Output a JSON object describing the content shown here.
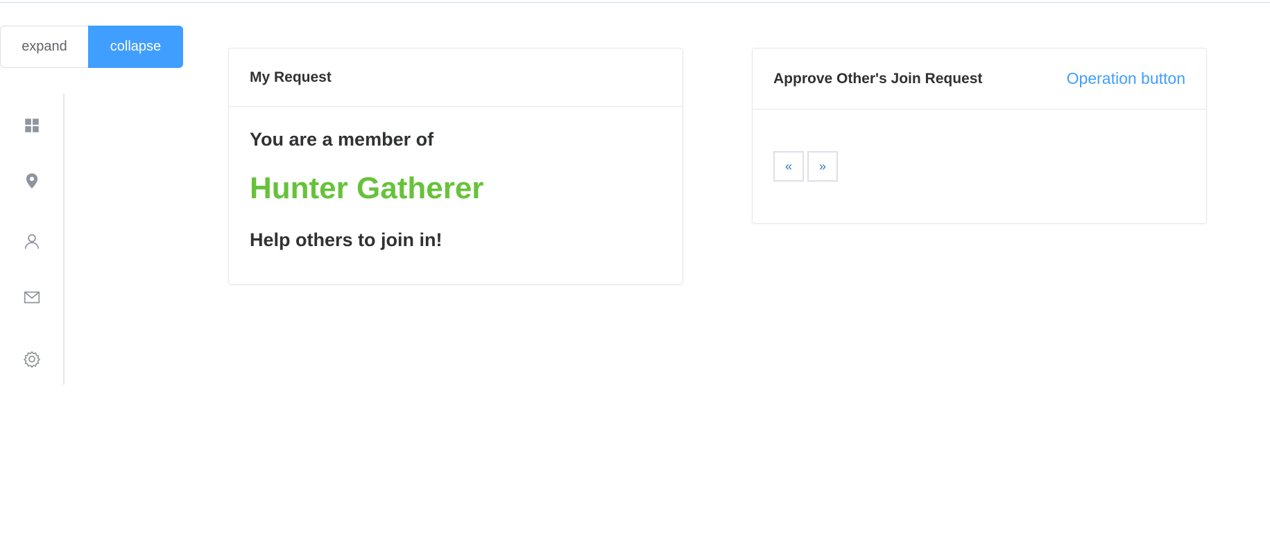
{
  "toggle": {
    "expand_label": "expand",
    "collapse_label": "collapse",
    "active": "collapse"
  },
  "sidebar": {
    "items": [
      {
        "icon": "grid-icon"
      },
      {
        "icon": "location-pin-icon"
      },
      {
        "icon": "user-icon"
      },
      {
        "icon": "mail-icon"
      },
      {
        "icon": "gear-icon"
      }
    ]
  },
  "my_request": {
    "title": "My Request",
    "member_text": "You are a member of",
    "team_name": "Hunter Gatherer",
    "help_text": "Help others to join in!"
  },
  "approve_requests": {
    "title": "Approve Other's Join Request",
    "operation_label": "Operation button",
    "pager": {
      "prev_label": "«",
      "next_label": "»"
    }
  },
  "colors": {
    "primary": "#409eff",
    "success": "#67c23a",
    "text": "#303133",
    "border": "#e4e7ed"
  }
}
